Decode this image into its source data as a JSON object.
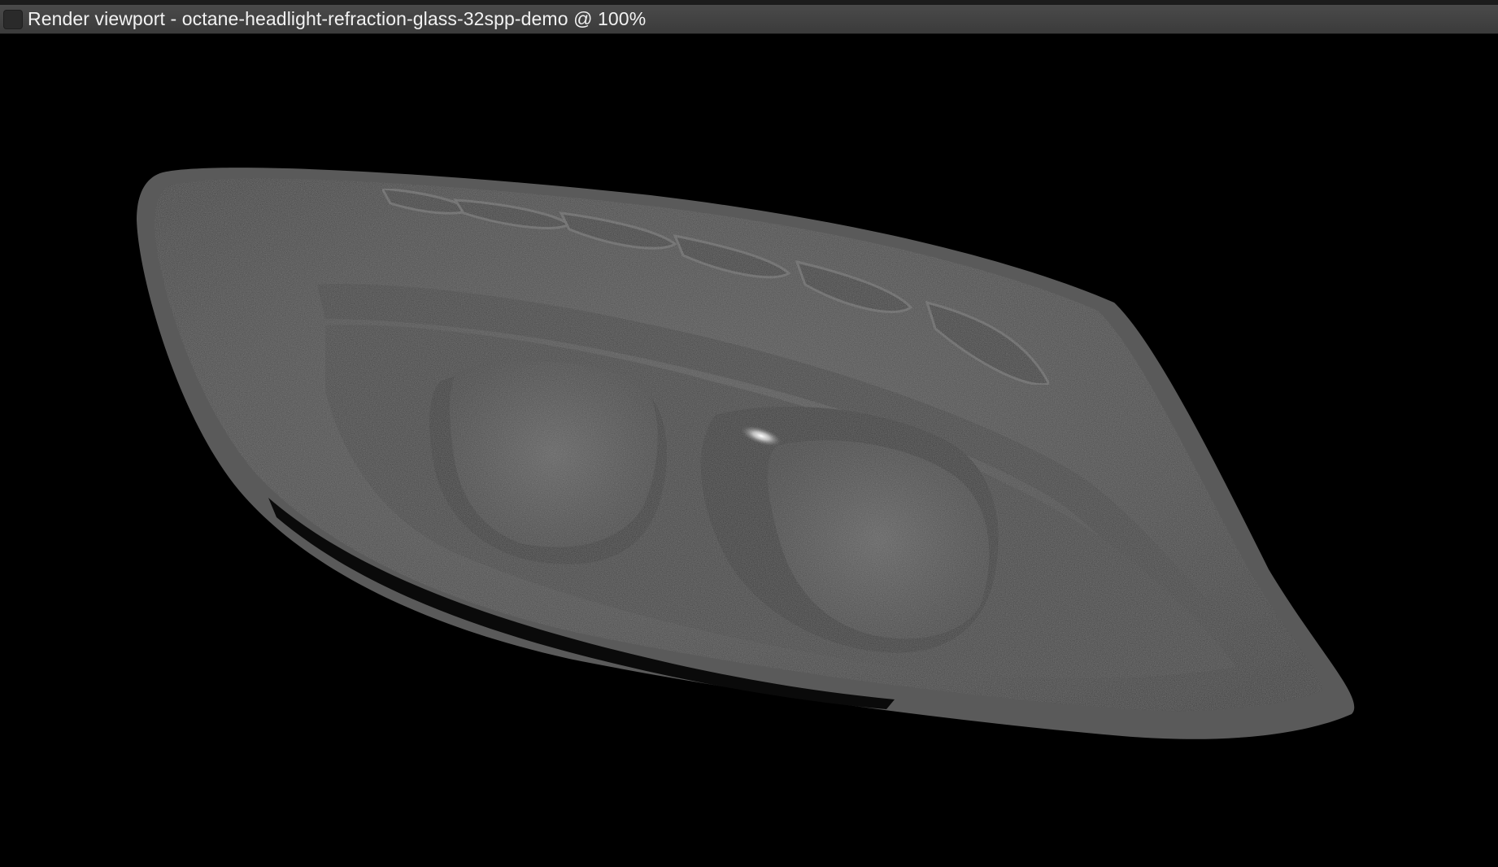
{
  "window": {
    "title": "Render viewport - octane-headlight-refraction-glass-32spp-demo @ 100%"
  },
  "viewport": {
    "background": "#000000",
    "render_subject": "headlight-render"
  }
}
